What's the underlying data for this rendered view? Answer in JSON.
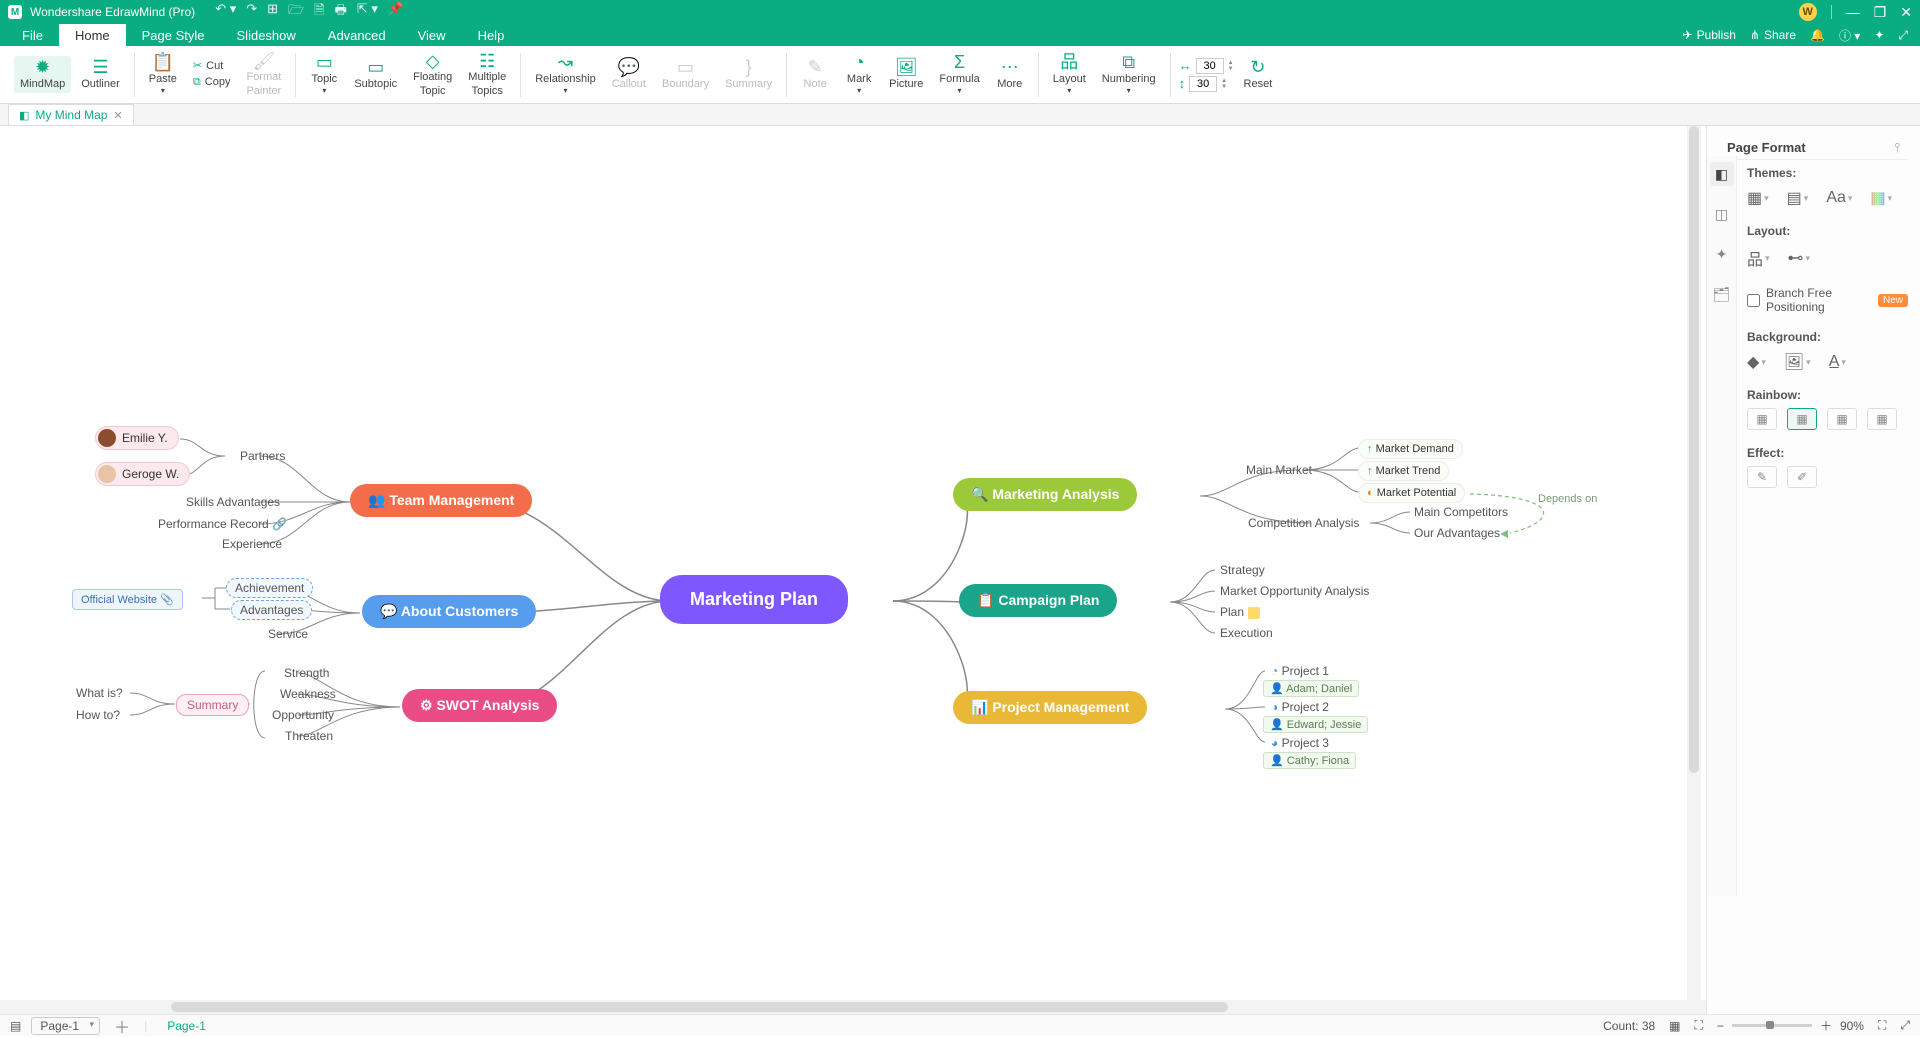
{
  "app_title": "Wondershare EdrawMind (Pro)",
  "window_controls": {
    "min": "—",
    "max": "❐",
    "close": "✕"
  },
  "avatar_letter": "W",
  "menubar": {
    "items": [
      "File",
      "Home",
      "Page Style",
      "Slideshow",
      "Advanced",
      "View",
      "Help"
    ],
    "active": "Home",
    "publish": "Publish",
    "share": "Share"
  },
  "ribbon": {
    "mindmap": "MindMap",
    "outliner": "Outliner",
    "paste": "Paste",
    "cut": "Cut",
    "copy": "Copy",
    "format_painter": "Format\nPainter",
    "topic": "Topic",
    "subtopic": "Subtopic",
    "floating_topic": "Floating\nTopic",
    "multiple_topics": "Multiple\nTopics",
    "relationship": "Relationship",
    "callout": "Callout",
    "boundary": "Boundary",
    "summary": "Summary",
    "note": "Note",
    "mark": "Mark",
    "picture": "Picture",
    "formula": "Formula",
    "more": "More",
    "layout": "Layout",
    "numbering": "Numbering",
    "reset": "Reset",
    "spinner_top": "30",
    "spinner_bottom": "30"
  },
  "tabs": {
    "tab1": "My Mind Map"
  },
  "sidepanel": {
    "title": "Page Format",
    "themes": "Themes:",
    "layout": "Layout:",
    "branch_free": "Branch Free Positioning",
    "new_badge": "New",
    "background": "Background:",
    "rainbow": "Rainbow:",
    "effect": "Effect:"
  },
  "status": {
    "page_select": "Page-1",
    "page_tab": "Page-1",
    "count": "Count: 38",
    "zoom": "90%"
  },
  "mindmap": {
    "central": "Marketing Plan",
    "left": {
      "team": {
        "label": "Team Management",
        "children": [
          "Partners",
          "Skills Advantages",
          "Performance Record",
          "Experience"
        ],
        "people": [
          "Emilie Y.",
          "Geroge W."
        ]
      },
      "about": {
        "label": "About Customers",
        "children": [
          "Achievement",
          "Advantages",
          "Service"
        ],
        "link": "Official Website"
      },
      "swot": {
        "label": "SWOT Analysis",
        "children": [
          "Strength",
          "Weakness",
          "Opportunity",
          "Threaten"
        ],
        "summary": "Summary",
        "summary_children": [
          "What is?",
          "How to?"
        ]
      }
    },
    "right": {
      "analysis": {
        "label": "Marketing Analysis",
        "children": [
          "Main Market",
          "Competition Analysis"
        ],
        "market_sub": [
          "Market Demand",
          "Market Trend",
          "Market Potential"
        ],
        "comp_sub": [
          "Main Competitors",
          "Our Advantages"
        ],
        "rel_label": "Depends on"
      },
      "campaign": {
        "label": "Campaign Plan",
        "children": [
          "Strategy",
          "Market Opportunity Analysis",
          "Plan",
          "Execution"
        ]
      },
      "project": {
        "label": "Project Management",
        "children": [
          "Project 1",
          "Project 2",
          "Project 3"
        ],
        "tags": [
          "Adam; Daniel",
          "Edward; Jessie",
          "Cathy; Fiona"
        ]
      }
    }
  }
}
